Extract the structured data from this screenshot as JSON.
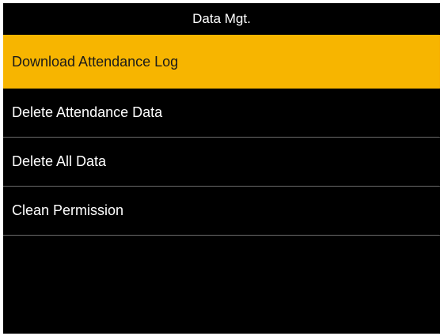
{
  "header": {
    "title": "Data Mgt."
  },
  "menu": {
    "items": [
      {
        "label": "Download Attendance Log",
        "selected": true
      },
      {
        "label": "Delete Attendance Data",
        "selected": false
      },
      {
        "label": "Delete All Data",
        "selected": false
      },
      {
        "label": "Clean Permission",
        "selected": false
      }
    ]
  },
  "colors": {
    "background": "#000000",
    "highlight": "#f7b500",
    "text": "#ffffff",
    "divider": "#6b6b6b"
  }
}
